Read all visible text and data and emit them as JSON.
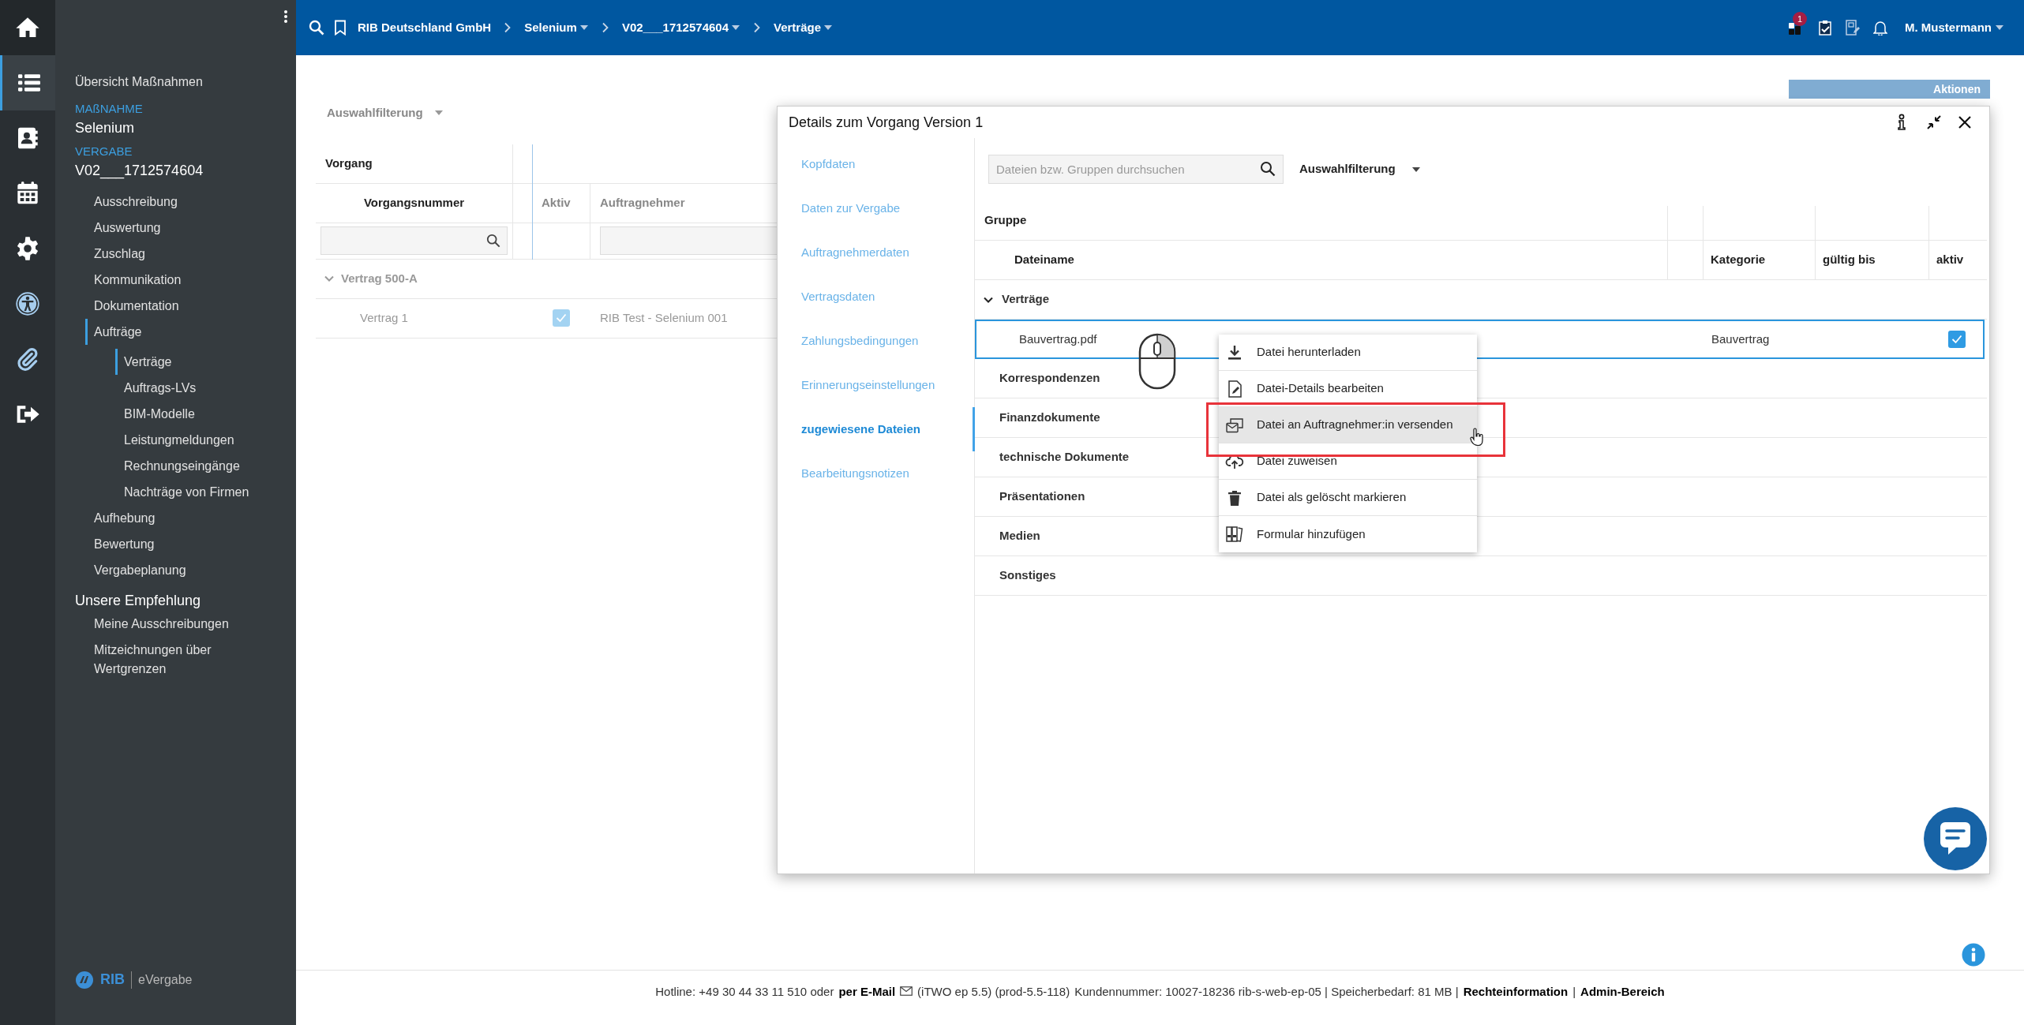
{
  "rail": [
    {
      "kind": "home",
      "selected": false
    },
    {
      "kind": "list",
      "selected": true
    },
    {
      "kind": "contacts",
      "selected": false
    },
    {
      "kind": "calendar",
      "selected": false
    },
    {
      "kind": "settings",
      "selected": false
    },
    {
      "kind": "accessibility",
      "selected": false
    },
    {
      "kind": "attachment",
      "selected": false
    },
    {
      "kind": "logout",
      "selected": false
    }
  ],
  "sidebar": {
    "overview": "Übersicht Maßnahmen",
    "context": [
      {
        "label": "MAßNAHME",
        "value": "Selenium"
      },
      {
        "label": "VERGABE",
        "value": "V02___1712574604"
      }
    ],
    "items": [
      {
        "label": "Ausschreibung",
        "selected": false
      },
      {
        "label": "Auswertung",
        "selected": false
      },
      {
        "label": "Zuschlag",
        "selected": false
      },
      {
        "label": "Kommunikation",
        "selected": false
      },
      {
        "label": "Dokumentation",
        "selected": false
      },
      {
        "label": "Aufträge",
        "selected": true,
        "children": [
          {
            "label": "Verträge",
            "selected": true
          },
          {
            "label": "Auftrags-LVs",
            "selected": false
          },
          {
            "label": "BIM-Modelle",
            "selected": false
          },
          {
            "label": "Leistungmeldungen",
            "selected": false
          },
          {
            "label": "Rechnungseingänge",
            "selected": false
          },
          {
            "label": "Nachträge von Firmen",
            "selected": false
          }
        ]
      },
      {
        "label": "Aufhebung",
        "selected": false
      },
      {
        "label": "Bewertung",
        "selected": false
      },
      {
        "label": "Vergabeplanung",
        "selected": false
      }
    ],
    "recommendation": {
      "title": "Unsere Empfehlung",
      "items": [
        "Meine Ausschreibungen",
        "Mitzeichnungen über Wertgrenzen"
      ]
    },
    "logo": {
      "brand": "RIB",
      "product": "eVergabe"
    }
  },
  "topbar": {
    "breadcrumbs": [
      {
        "label": "RIB Deutschland GmbH",
        "dropdown": false
      },
      {
        "label": "Selenium",
        "dropdown": true
      },
      {
        "label": "V02___1712574604",
        "dropdown": true
      },
      {
        "label": "Verträge",
        "dropdown": true
      }
    ],
    "tasks_badge": "1",
    "user": "M. Mustermann"
  },
  "background": {
    "filter": "Auswahlfilterung",
    "group_header": "Vorgang",
    "columns": [
      "Vorgangsnummer",
      "Aktiv",
      "Auftragnehmer"
    ],
    "group": {
      "label": "Vertrag 500-A",
      "expanded": true
    },
    "rows": [
      {
        "number": "Vertrag 1",
        "active": true,
        "contractor": "RIB Test - Selenium 001"
      }
    ],
    "actions": "Aktionen"
  },
  "dialog": {
    "title": "Details zum Vorgang Version 1",
    "nav": [
      {
        "label": "Kopfdaten",
        "selected": false
      },
      {
        "label": "Daten zur Vergabe",
        "selected": false
      },
      {
        "label": "Auftragnehmerdaten",
        "selected": false
      },
      {
        "label": "Vertragsdaten",
        "selected": false
      },
      {
        "label": "Zahlungsbedingungen",
        "selected": false
      },
      {
        "label": "Erinnerungseinstellungen",
        "selected": false
      },
      {
        "label": "zugewiesene Dateien",
        "selected": true
      },
      {
        "label": "Bearbeitungsnotizen",
        "selected": false
      }
    ],
    "search": {
      "placeholder": "Dateien bzw. Gruppen durchsuchen"
    },
    "filter": "Auswahlfilterung",
    "group_header": "Gruppe",
    "columns": [
      "Dateiname",
      "Kategorie",
      "gültig bis",
      "aktiv"
    ],
    "groups": [
      {
        "label": "Verträge",
        "expanded": true,
        "files": [
          {
            "name": "Bauvertrag.pdf",
            "category": "Bauvertrag",
            "active": true,
            "selected": true
          }
        ]
      },
      {
        "label": "Korrespondenzen",
        "expanded": false
      },
      {
        "label": "Finanzdokumente",
        "expanded": false
      },
      {
        "label": "technische Dokumente",
        "expanded": false
      },
      {
        "label": "Präsentationen",
        "expanded": false
      },
      {
        "label": "Medien",
        "expanded": false
      },
      {
        "label": "Sonstiges",
        "expanded": false
      }
    ]
  },
  "context_menu": {
    "items": [
      {
        "kind": "download",
        "label": "Datei herunterladen",
        "selected": false
      },
      {
        "kind": "edit",
        "label": "Datei-Details bearbeiten",
        "selected": false
      },
      {
        "kind": "send",
        "label": "Datei an Auftragnehmer:in versenden",
        "selected": true
      },
      {
        "kind": "assign",
        "label": "Datei zuweisen",
        "selected": false
      },
      {
        "kind": "delete",
        "label": "Datei als gelöscht markieren",
        "selected": false
      },
      {
        "kind": "form",
        "label": "Formular hinzufügen",
        "selected": false
      }
    ]
  },
  "footer": [
    {
      "kind": "text",
      "text": "Hotline: +49 30 44 33 11 510 oder"
    },
    {
      "kind": "email_link",
      "text": "per E-Mail"
    },
    {
      "kind": "text",
      "text": "(iTWO ep 5.5) (prod-5.5-118)"
    },
    {
      "kind": "text",
      "text": "Kundennummer: 10027-18236 rib-s-web-ep-05 | Speicherbedarf: 81 MB |"
    },
    {
      "kind": "link",
      "text": "Rechteinformation"
    },
    {
      "kind": "text",
      "text": "|"
    },
    {
      "kind": "link",
      "text": "Admin-Bereich"
    }
  ]
}
